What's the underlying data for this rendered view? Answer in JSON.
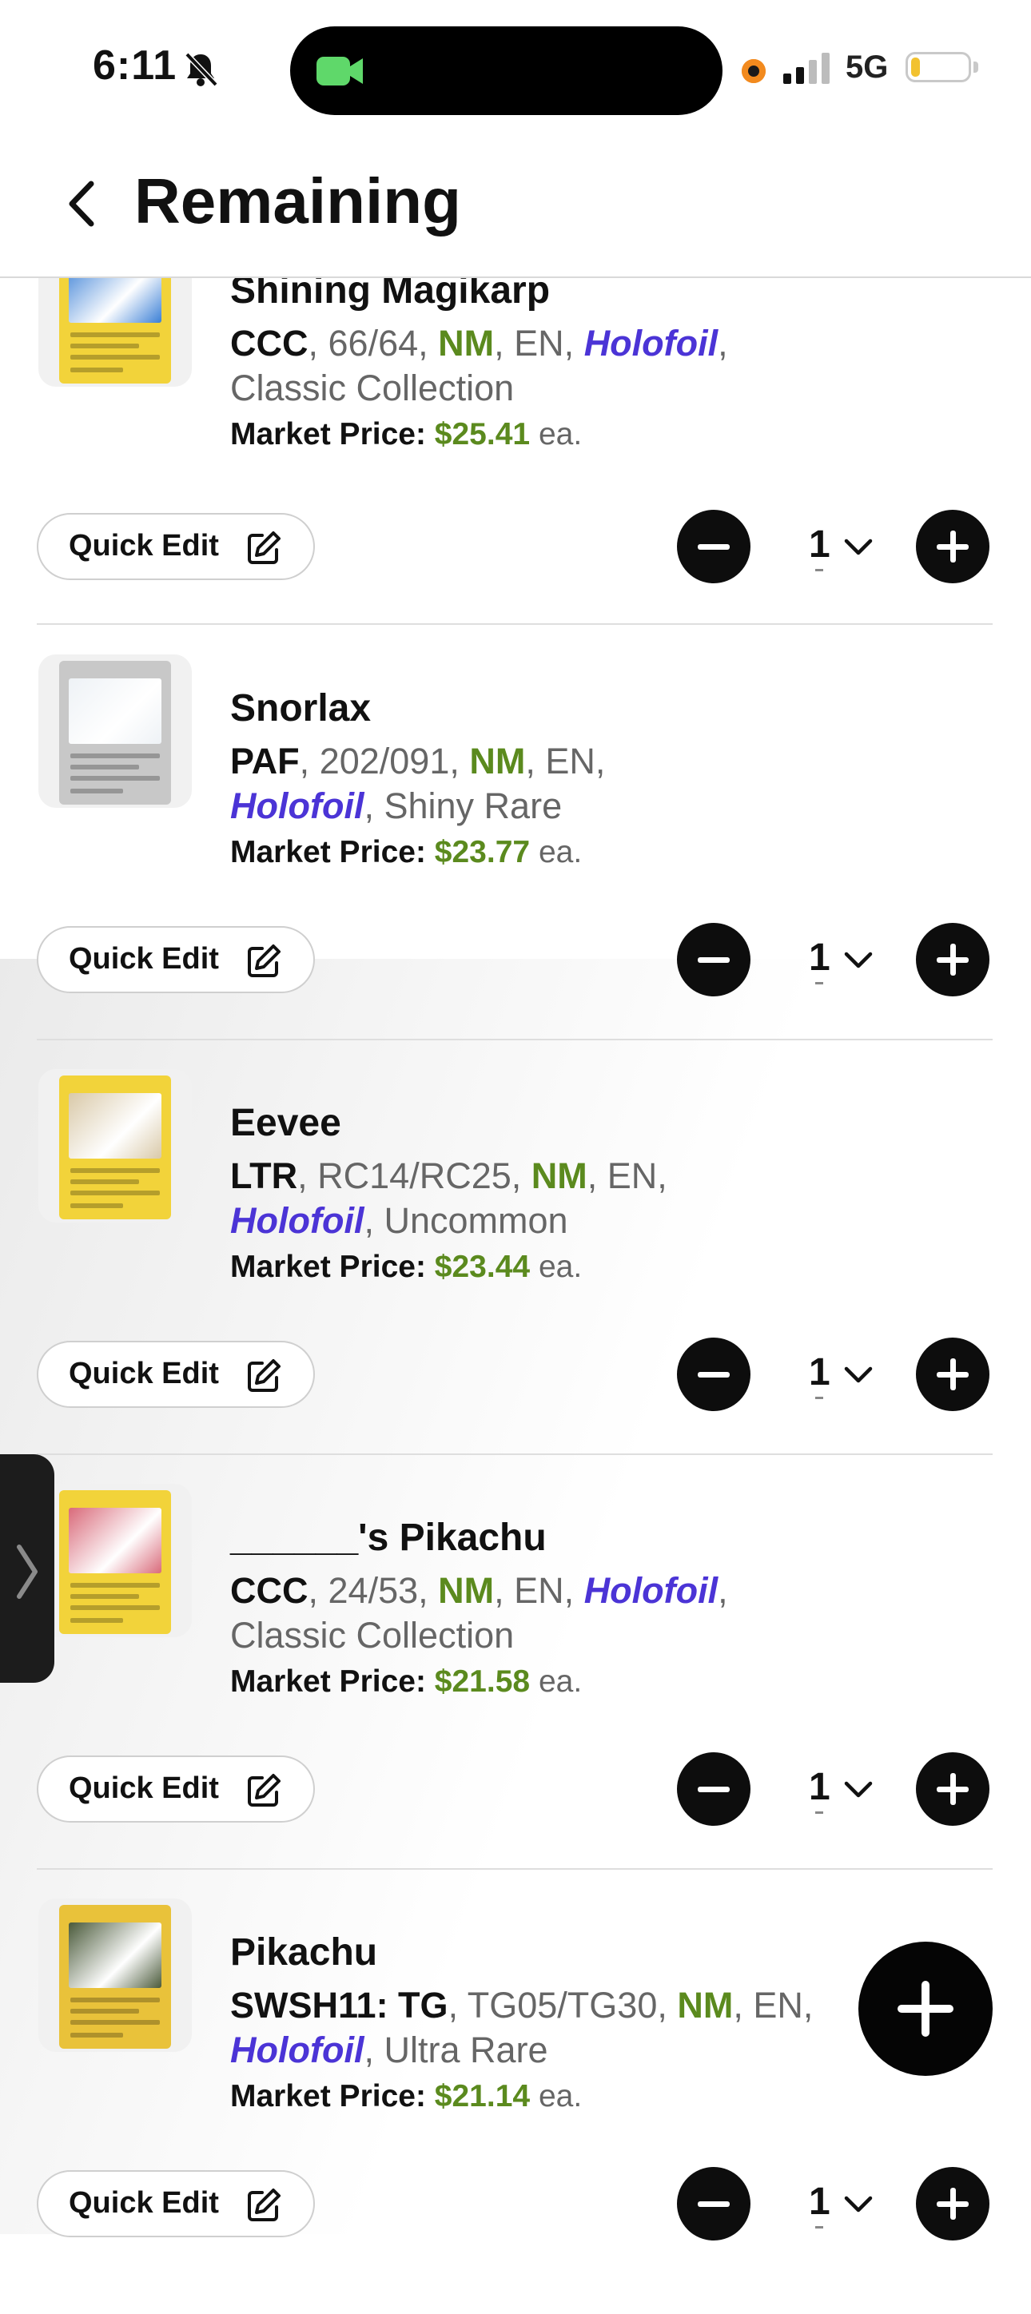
{
  "status_bar": {
    "time": "6:11",
    "network": "5G",
    "battery_level": 0.15
  },
  "header": {
    "title": "Remaining"
  },
  "items": [
    {
      "name": "Shining Magikarp",
      "set_code": "CCC",
      "number": "66/64",
      "condition": "NM",
      "language": "EN",
      "finish": "Holofoil",
      "rarity": "Classic Collection",
      "price_label": "Market Price:",
      "price": "$25.41",
      "price_suffix": "ea.",
      "quantity": "1",
      "quick_edit": "Quick Edit",
      "card_colors": [
        "#f2d33a",
        "#3a7fd6"
      ]
    },
    {
      "name": "Snorlax",
      "set_code": "PAF",
      "number": "202/091",
      "condition": "NM",
      "language": "EN",
      "finish": "Holofoil",
      "rarity": "Shiny Rare",
      "price_label": "Market Price:",
      "price": "$23.77",
      "price_suffix": "ea.",
      "quantity": "1",
      "quick_edit": "Quick Edit",
      "card_colors": [
        "#c8c8c8",
        "#eef2f6"
      ]
    },
    {
      "name": "Eevee",
      "set_code": "LTR",
      "number": "RC14/RC25",
      "condition": "NM",
      "language": "EN",
      "finish": "Holofoil",
      "rarity": "Uncommon",
      "price_label": "Market Price:",
      "price": "$23.44",
      "price_suffix": "ea.",
      "quantity": "1",
      "quick_edit": "Quick Edit",
      "card_colors": [
        "#f2d33a",
        "#d9c9a8"
      ]
    },
    {
      "name": "______'s Pikachu",
      "set_code": "CCC",
      "number": "24/53",
      "condition": "NM",
      "language": "EN",
      "finish": "Holofoil",
      "rarity": "Classic Collection",
      "price_label": "Market Price:",
      "price": "$21.58",
      "price_suffix": "ea.",
      "quantity": "1",
      "quick_edit": "Quick Edit",
      "card_colors": [
        "#f2d33a",
        "#d96a7a"
      ]
    },
    {
      "name": "Pikachu",
      "set_code": "SWSH11: TG",
      "number": "TG05/TG30",
      "condition": "NM",
      "language": "EN",
      "finish": "Holofoil",
      "rarity": "Ultra Rare",
      "price_label": "Market Price:",
      "price": "$21.14",
      "price_suffix": "ea.",
      "quantity": "1",
      "quick_edit": "Quick Edit",
      "card_colors": [
        "#e9c23a",
        "#4a5a3a"
      ]
    }
  ],
  "fab": {
    "icon": "plus-icon"
  },
  "side_handle": {
    "icon": "chevron-right-icon"
  },
  "colors": {
    "condition": "#5b8a1e",
    "finish": "#4b34d6",
    "price": "#5b8a1e"
  }
}
